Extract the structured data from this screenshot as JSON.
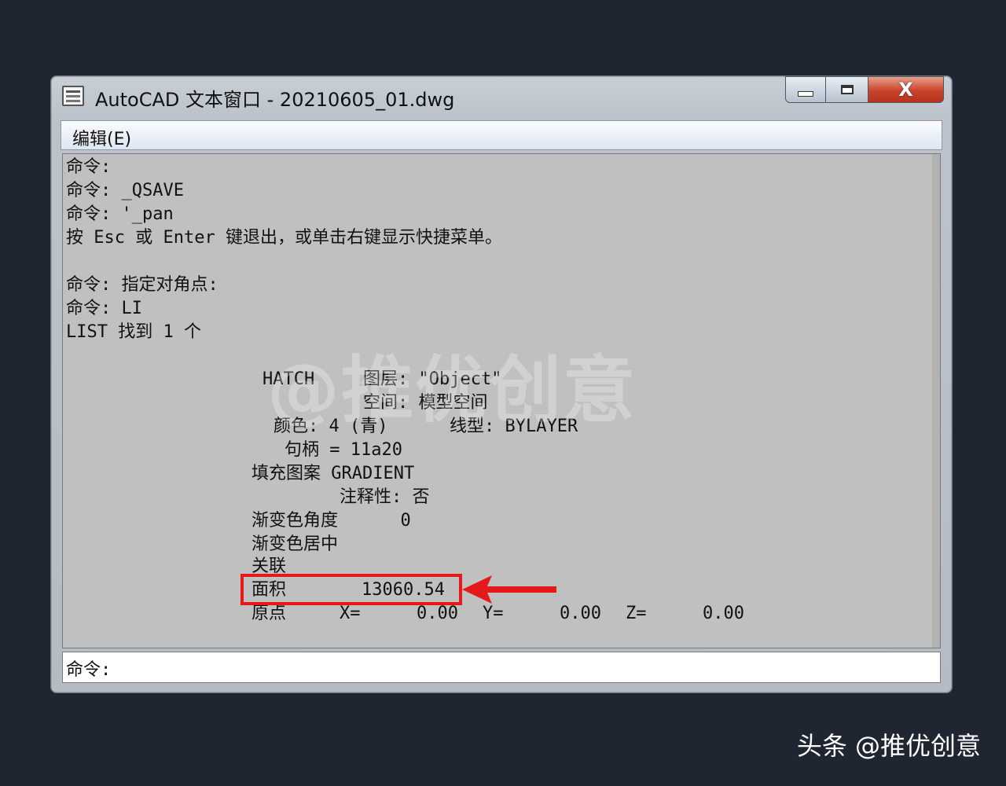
{
  "window": {
    "title": "AutoCAD 文本窗口 - 20210605_01.dwg",
    "close_label": "X"
  },
  "menu": {
    "edit": "编辑(E)"
  },
  "history": {
    "l1": "命令:",
    "l2": "命令: _QSAVE",
    "l3": "命令: '_pan",
    "l4": "按 Esc 或 Enter 键退出，或单击右键显示快捷菜单。",
    "l5": "命令: 指定对角点:",
    "l6": "命令: LI",
    "l7": "LIST 找到 1 个",
    "hatch": "HATCH",
    "layer": "图层: \"Object\"",
    "space": "空间: 模型空间",
    "color": "颜色: 4 (青)",
    "linetype": "线型: BYLAYER",
    "handle": "句柄 = 11a20",
    "fill_pattern": "填充图案 GRADIENT",
    "annotative": "注释性: 否",
    "grad_angle": "渐变色角度      0",
    "grad_center": "渐变色居中",
    "assoc": "关联",
    "area_label": "面积",
    "area_value": "13060.54",
    "origin": "原点",
    "x_label": "X=",
    "x_value": "0.00",
    "y_label": "Y=",
    "y_value": "0.00",
    "z_label": "Z=",
    "z_value": "0.00"
  },
  "command_line": {
    "prompt": "命令:",
    "value": ""
  },
  "watermark": "@推优创意",
  "footer": "头条 @推优创意",
  "colors": {
    "highlight": "#e41a1a",
    "background": "#1f2631",
    "text_area": "#c0c0c0"
  }
}
